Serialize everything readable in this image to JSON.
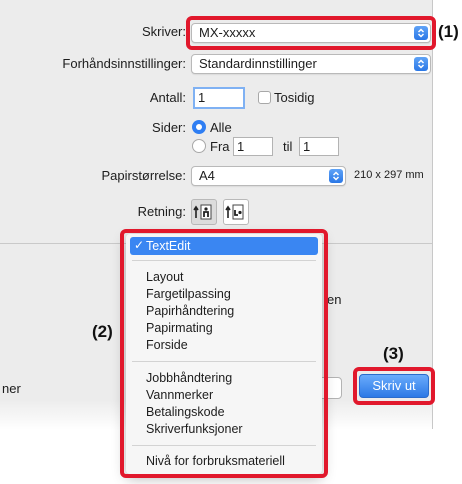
{
  "printer": {
    "label": "Skriver:",
    "value": "MX-xxxxx"
  },
  "presets": {
    "label": "Forhåndsinnstillinger:",
    "value": "Standardinnstillinger"
  },
  "copies": {
    "label": "Antall:",
    "value": "1",
    "two_sided_label": "Tosidig"
  },
  "pages": {
    "label": "Sider:",
    "all_label": "Alle",
    "from_label": "Fra",
    "from_value": "1",
    "to_label": "til",
    "to_value": "1"
  },
  "paper_size": {
    "label": "Papirstørrelse:",
    "value": "A4",
    "dimensions": "210 x 297 mm"
  },
  "orientation": {
    "label": "Retning:"
  },
  "menu": {
    "selected": "TextEdit",
    "group1": [
      "Layout",
      "Fargetilpassing",
      "Papirhåndtering",
      "Papirmating",
      "Forside"
    ],
    "group2": [
      "Jobbhåndtering",
      "Vannmerker",
      "Betalingskode",
      "Skriverfunksjoner"
    ],
    "group3": [
      "Nivå for forbruksmateriell"
    ]
  },
  "background_fragments": {
    "right_text": "en",
    "left_text": "ner"
  },
  "print_button": {
    "label": "Skriv ut"
  },
  "callouts": {
    "c1": "(1)",
    "c2": "(2)",
    "c3": "(3)"
  },
  "colors": {
    "accent": "#2f7ef3",
    "highlight_border": "#e1182c"
  }
}
